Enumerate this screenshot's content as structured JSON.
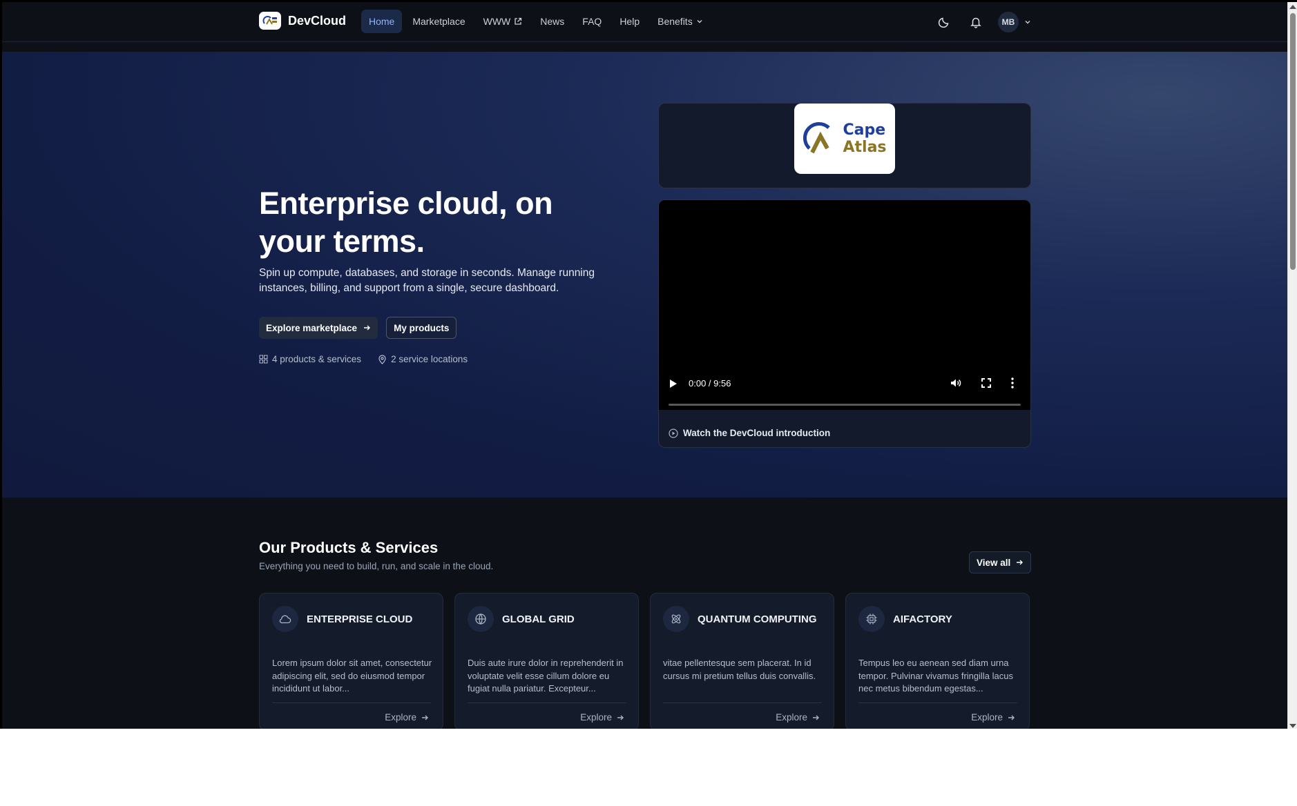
{
  "app": {
    "name": "DevCloud"
  },
  "nav": {
    "items": [
      {
        "label": "Home",
        "active": true
      },
      {
        "label": "Marketplace"
      },
      {
        "label": "WWW",
        "external": true
      },
      {
        "label": "News"
      },
      {
        "label": "FAQ"
      },
      {
        "label": "Help"
      },
      {
        "label": "Benefits",
        "dropdown": true
      }
    ]
  },
  "user": {
    "initials": "MB"
  },
  "hero": {
    "title": "Enterprise cloud, on your terms.",
    "subtitle": "Spin up compute, databases, and storage in seconds. Manage running instances, billing, and support from a single, secure dashboard.",
    "primary_cta": "Explore marketplace",
    "secondary_cta": "My products",
    "meta": [
      {
        "icon": "grid-icon",
        "label": "4 products & services"
      },
      {
        "icon": "map-pin-icon",
        "label": "2 service locations"
      }
    ]
  },
  "partner_logo": {
    "line1": "Cape",
    "line2": "Atlas"
  },
  "video": {
    "time": "0:00 / 9:56",
    "progress": 0,
    "caption": "Watch the DevCloud introduction"
  },
  "products": {
    "title": "Our Products & Services",
    "subtitle": "Everything you need to build, run, and scale in the cloud.",
    "view_all": "View all",
    "cards": [
      {
        "icon": "cloud-icon",
        "title": "ENTERPRISE CLOUD",
        "desc": "Lorem ipsum dolor sit amet, consectetur adipiscing elit, sed do eiusmod tempor incididunt ut labor...",
        "cta": "Explore"
      },
      {
        "icon": "globe-icon",
        "title": "GLOBAL GRID",
        "desc": "Duis aute irure dolor in reprehenderit in voluptate velit esse cillum dolore eu fugiat nulla pariatur. Excepteur...",
        "cta": "Explore"
      },
      {
        "icon": "atom-icon",
        "title": "QUANTUM COMPUTING",
        "desc": "vitae pellentesque sem placerat. In id cursus mi pretium tellus duis convallis.",
        "cta": "Explore"
      },
      {
        "icon": "cpu-icon",
        "title": "AIFACTORY",
        "desc": "Tempus leo eu aenean sed diam urna tempor. Pulvinar vivamus fringilla lacus nec metus bibendum egestas...",
        "cta": "Explore"
      }
    ]
  },
  "colors": {
    "accent": "#8fb2ff",
    "hero_bg": "#111a3d",
    "page_bg": "#0d1117"
  }
}
